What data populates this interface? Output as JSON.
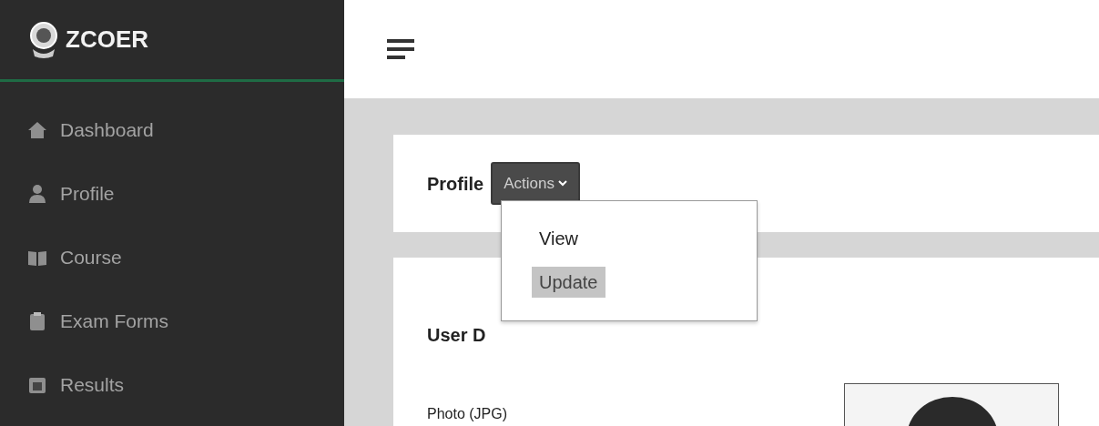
{
  "brand": {
    "name": "ZCOER"
  },
  "sidebar": {
    "items": [
      {
        "label": "Dashboard",
        "kind": "home"
      },
      {
        "label": "Profile",
        "kind": "user"
      },
      {
        "label": "Course",
        "kind": "book"
      },
      {
        "label": "Exam Forms",
        "kind": "form"
      },
      {
        "label": "Results",
        "kind": "calendar"
      }
    ]
  },
  "profile_card": {
    "title": "Profile",
    "actions_button": "Actions",
    "menu": [
      {
        "label": "View",
        "selected": false
      },
      {
        "label": "Update",
        "selected": true
      }
    ]
  },
  "details_card": {
    "title": "User D",
    "photo_label": "Photo (JPG)"
  }
}
